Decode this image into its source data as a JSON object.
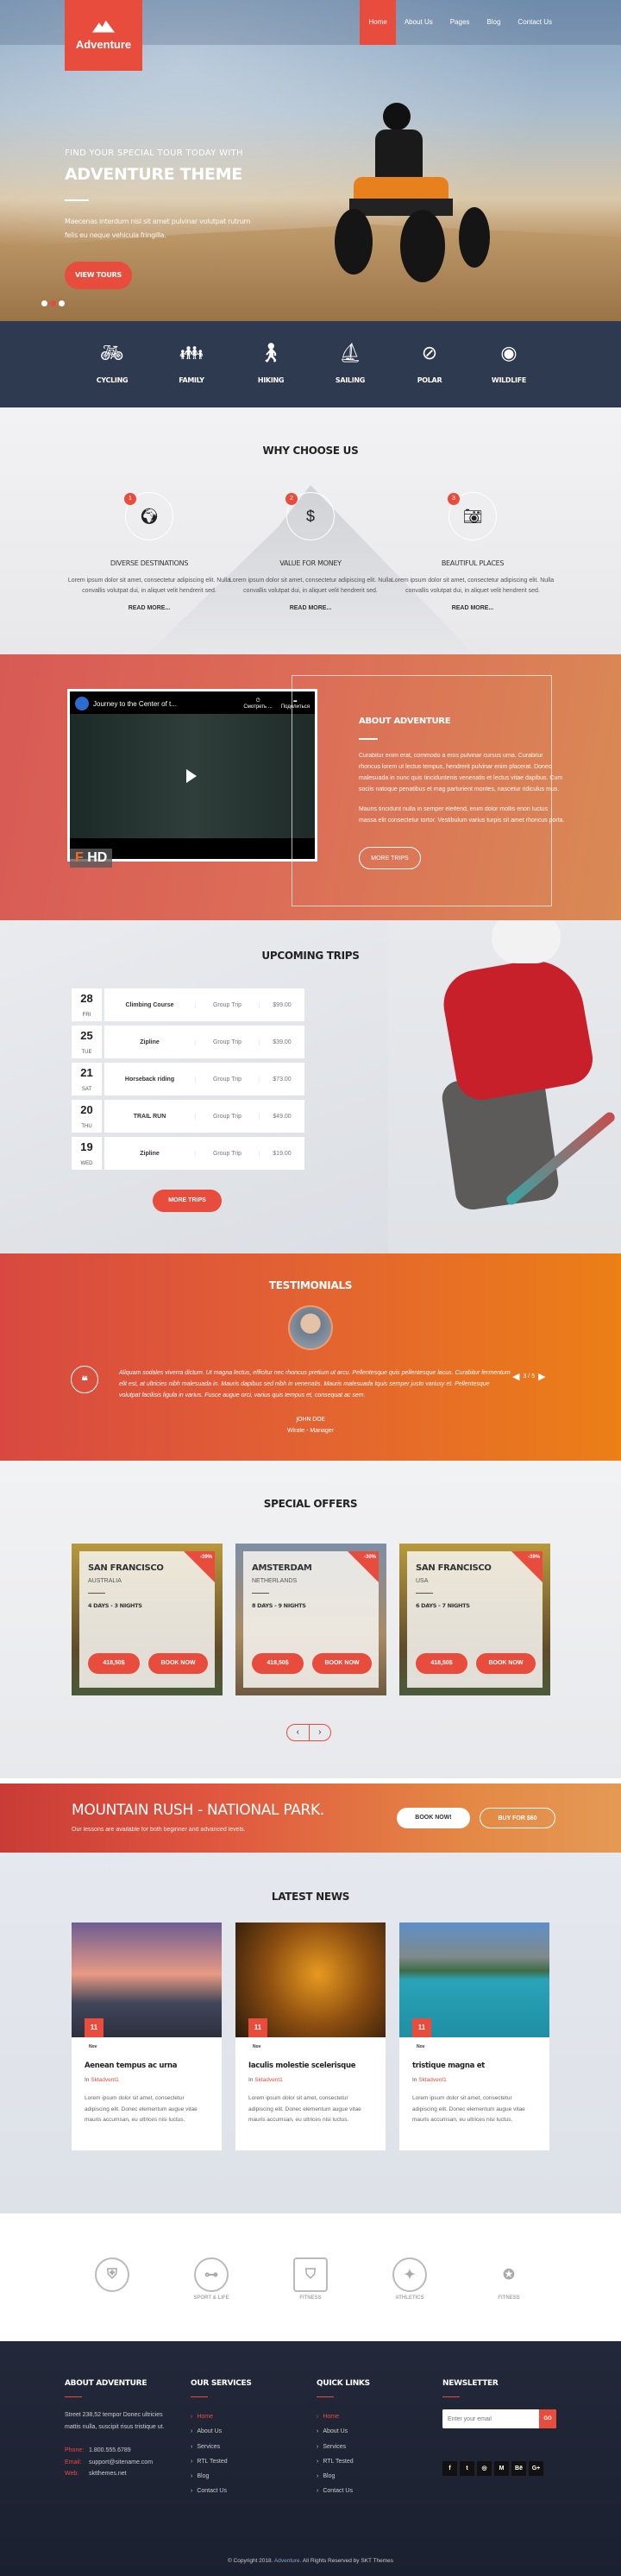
{
  "nav": {
    "logo_text": "Adventure",
    "items": [
      {
        "label": "Home",
        "active": true
      },
      {
        "label": "About Us"
      },
      {
        "label": "Pages"
      },
      {
        "label": "Blog"
      },
      {
        "label": "Contact Us"
      }
    ]
  },
  "hero": {
    "pretitle": "FIND YOUR SPECIAL TOUR TODAY WITH",
    "title": "ADVENTURE THEME",
    "text": "Maecenas interdum nisl sit amet pulvinar volutpat rutrum felis eu neque vehicula fringilla.",
    "button": "VIEW TOURS",
    "slides": 3,
    "active_slide": 2
  },
  "categories": [
    {
      "label": "CYCLING",
      "icon": "cyclist-icon"
    },
    {
      "label": "FAMILY",
      "icon": "family-icon"
    },
    {
      "label": "HIKING",
      "icon": "hiker-icon"
    },
    {
      "label": "SAILING",
      "icon": "sailboat-icon"
    },
    {
      "label": "POLAR",
      "icon": "compass-icon"
    },
    {
      "label": "WILDLIFE",
      "icon": "wolf-icon"
    }
  ],
  "why": {
    "title": "WHY CHOOSE US",
    "items": [
      {
        "num": "1",
        "icon": "globe-icon",
        "title": "DIVERSE DESTINATIONS",
        "text": "Lorem ipsum dolor sit amet, consectetur adipiscing elit. Nulla convallis volutpat dui, in aliquet velit hendrerit sed.",
        "link": "READ MORE..."
      },
      {
        "num": "2",
        "icon": "dollar-icon",
        "title": "VALUE FOR MONEY",
        "text": "Lorem ipsum dolor sit amet, consectetur adipiscing elit. Nulla convallis volutpat dui, in aliquet velit hendrerit sed.",
        "link": "READ MORE..."
      },
      {
        "num": "3",
        "icon": "camera-icon",
        "title": "BEAUTIFUL PLACES",
        "text": "Lorem ipsum dolor sit amet, consectetur adipiscing elit. Nulla convallis volutpat dui, in aliquet velit hendrerit sed.",
        "link": "READ MORE..."
      }
    ]
  },
  "about": {
    "video_title": "Journey to the Center of t...",
    "video_watch": "Смотреть ...",
    "video_share": "Поделиться",
    "video_badge": "HD",
    "title": "ABOUT ADVENTURE",
    "p1": "Curabitur enim erat, commodo a eros pulvinar cursus urna. Curabitur rhoncus lorem ut lectus tempus, hendrerit pulvinar enim placerat. Donec malesuada in nunc quis tinciduntenis venenatis et lectus vitae dapibus. Cum sociis natoque penatibus et mag parturient montes, nascetur ridiculus mus.",
    "p2": "Mauris tincidunt nulla in semper eleifend, enim dolor mollis enon luctus massa elit consectetur tortor. Vestibulum varius turpis sit amet rhoncus porta.",
    "button": "MORE TRIPS"
  },
  "trips": {
    "title": "UPCOMING TRIPS",
    "rows": [
      {
        "day": "28",
        "dow": "FRI",
        "name": "Climbing Course",
        "type": "Group Trip",
        "price": "$99.00"
      },
      {
        "day": "25",
        "dow": "TUE",
        "name": "Zipline",
        "type": "Group Trip",
        "price": "$39.00"
      },
      {
        "day": "21",
        "dow": "SAT",
        "name": "Horseback riding",
        "type": "Group Trip",
        "price": "$73.00"
      },
      {
        "day": "20",
        "dow": "THU",
        "name": "TRAIL RUN",
        "type": "Group Trip",
        "price": "$49.00"
      },
      {
        "day": "19",
        "dow": "WED",
        "name": "Zipline",
        "type": "Group Trip",
        "price": "$19.00"
      }
    ],
    "button": "MORE TRIPS"
  },
  "testimonials": {
    "title": "TESTIMONIALS",
    "text": "Aliquam sodales viverra dictum. Ut magna lectus, efficitur nec rhoncus pretium ut arcu. Pellentesque quis pellentesque lacus. Curabitur fermentum elit est, at ultricies nibh malesuada in. Mauris dapibus sed nibh in venenatis. Mauris malesuada tquis semper justo variusy et. Pellentesque volutpat facilisis ligula in varius. Fusce augue orci, varius quis tempus et, consequat ac sem.",
    "name": "JOHN DOE",
    "role": "Wirate - Manager",
    "counter": "3 / 5"
  },
  "offers": {
    "title": "SPECIAL OFFERS",
    "items": [
      {
        "city": "SAN FRANCISCO",
        "country": "AUSTRALIA",
        "duration": "4 DAYS - 3 NIGHTS",
        "discount": "-39%",
        "price": "418,50$",
        "button": "BOOK NOW"
      },
      {
        "city": "AMSTERDAM",
        "country": "NETHERLANDS",
        "duration": "8 DAYS - 9 NIGHTS",
        "discount": "-30%",
        "price": "418,50$",
        "button": "BOOK NOW"
      },
      {
        "city": "SAN FRANCISCO",
        "country": "USA",
        "duration": "6 DAYS - 7 NIGHTS",
        "discount": "-39%",
        "price": "418,50$",
        "button": "BOOK NOW"
      }
    ],
    "prev": "‹",
    "next": "›"
  },
  "cta": {
    "title": "MOUNTAIN RUSH - NATIONAL PARK.",
    "text": "Our lessons are available for both beginner and advanced levels.",
    "book": "BOOK NOW!",
    "buy": "BUY FOR $60"
  },
  "news": {
    "title": "LATEST NEWS",
    "items": [
      {
        "day": "11",
        "month": "Nov",
        "title": "Aenean tempus ac urna",
        "in": "In",
        "category": "Sktadvent1",
        "text": "Lorem ipsum dolor sit amet, consectetur adipiscing elit. Donec elementum augue vitae mauris accumsan, eu ultrices nisi luctus."
      },
      {
        "day": "11",
        "month": "Nov",
        "title": "Iaculis molestie scelerisque",
        "in": "In",
        "category": "Sktadvent1",
        "text": "Lorem ipsum dolor sit amet, consectetur adipiscing elit. Donec elementum augue vitae mauris accumsan, eu ultrices nisi luctus."
      },
      {
        "day": "11",
        "month": "Nov",
        "title": "tristique magna et",
        "in": "In",
        "category": "Sktadvent1",
        "text": "Lorem ipsum dolor sit amet, consectetur adipiscing elit. Donec elementum augue vitae mauris accumsan, eu ultrices nisi luctus."
      }
    ]
  },
  "brands": [
    {
      "label": "",
      "icon": "helmet-logo-icon"
    },
    {
      "label": "SPORT & LIFE",
      "icon": "dumbbell-logo-icon"
    },
    {
      "label": "FITNESS",
      "icon": "bodybuilder-logo-icon"
    },
    {
      "label": "ATHLETICS",
      "icon": "winged-shoe-logo-icon"
    },
    {
      "label": "FITNESS",
      "icon": "fitness-woman-logo-icon"
    }
  ],
  "footer": {
    "about_title": "ABOUT ADVENTURE",
    "address": "Street 238,52 tempor Donec ultricies mattis nulla, suscipit risus tristique ut.",
    "phone_label": "Phone:",
    "phone": "1.800.555.6789",
    "email_label": "Email:",
    "email": "support@sitename.com",
    "web_label": "Web:",
    "web": "sktthemes.net",
    "services_title": "OUR SERVICES",
    "services": [
      "Home",
      "About Us",
      "Services",
      "RTL Tested",
      "Blog",
      "Contact Us"
    ],
    "links_title": "QUICK LINKS",
    "links": [
      "Home",
      "About Us",
      "Services",
      "RTL Tested",
      "Blog",
      "Contact Us"
    ],
    "newsletter_title": "NEWSLETTER",
    "email_placeholder": "Enter your email",
    "go": "GO",
    "social": [
      {
        "name": "facebook-icon",
        "glyph": "f"
      },
      {
        "name": "twitter-icon",
        "glyph": "t"
      },
      {
        "name": "instagram-icon",
        "glyph": "◎"
      },
      {
        "name": "medium-icon",
        "glyph": "M"
      },
      {
        "name": "behance-icon",
        "glyph": "Bē"
      },
      {
        "name": "google-plus-icon",
        "glyph": "G+"
      }
    ],
    "copyright_pre": "© Copyright 2018.",
    "copyright_brand": "Adventure.",
    "copyright_post": "All Rights Reserved by SKT Themes"
  },
  "colors": {
    "accent": "#e74c3c",
    "dark": "#2e3a4f",
    "footer": "#1f2433"
  }
}
